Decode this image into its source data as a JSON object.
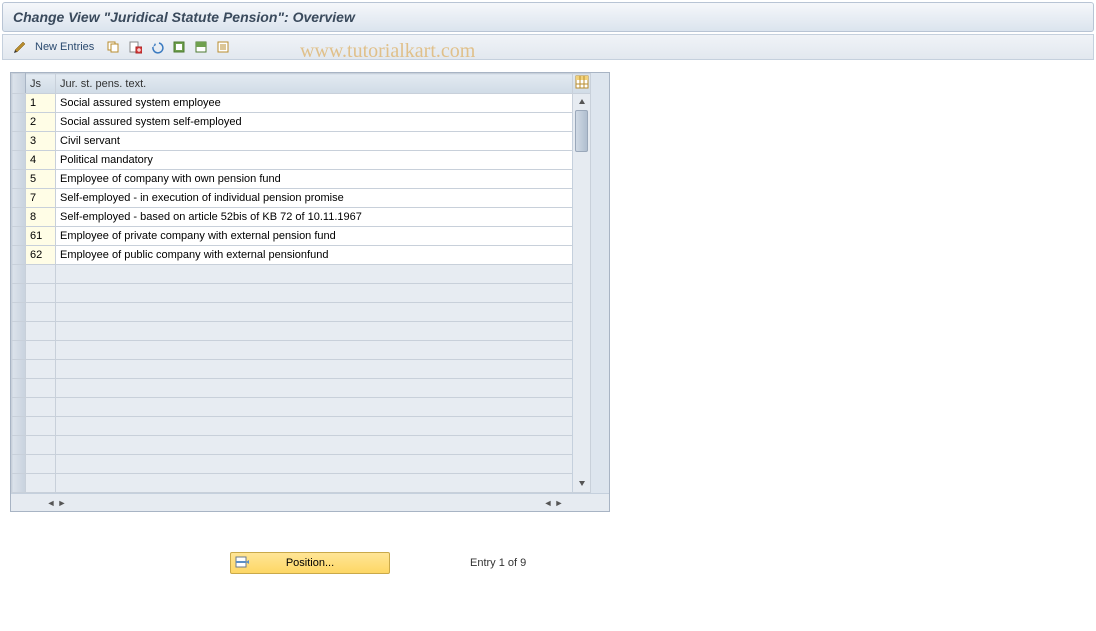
{
  "title": "Change View \"Juridical Statute Pension\": Overview",
  "watermark": "www.tutorialkart.com",
  "toolbar": {
    "new_entries": "New Entries"
  },
  "columns": {
    "js": "Js",
    "text": "Jur. st. pens. text."
  },
  "rows": [
    {
      "id": "1",
      "js": "1",
      "text": "Social assured system employee"
    },
    {
      "id": "2",
      "js": "2",
      "text": "Social assured system self-employed"
    },
    {
      "id": "3",
      "js": "3",
      "text": "Civil servant"
    },
    {
      "id": "4",
      "js": "4",
      "text": "Political mandatory"
    },
    {
      "id": "5",
      "js": "5",
      "text": "Employee of company with own pension fund"
    },
    {
      "id": "7",
      "js": "7",
      "text": "Self-employed - in execution of individual pension promise"
    },
    {
      "id": "8",
      "js": "8",
      "text": "Self-employed - based on article 52bis of KB 72 of 10.11.1967"
    },
    {
      "id": "61",
      "js": "61",
      "text": "Employee of private company with external pension fund"
    },
    {
      "id": "62",
      "js": "62",
      "text": "Employee of public company with external pensionfund"
    }
  ],
  "position_button": "Position...",
  "status": "Entry 1 of 9"
}
